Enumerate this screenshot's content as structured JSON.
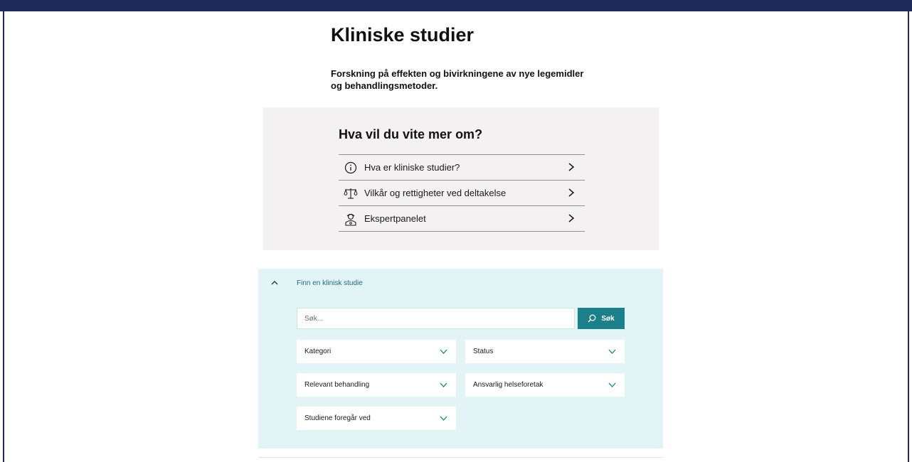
{
  "theme": {
    "topbar_color": "#1e2a57",
    "panel_background": "#f3f1f1",
    "search_panel_background": "#e3f4f6",
    "accent": "#1b7f8c"
  },
  "page": {
    "title": "Kliniske studier",
    "intro": "Forskning på effekten og bivirkningene av nye legemidler og behandlingsmetoder."
  },
  "info_box": {
    "heading": "Hva vil du vite mer om?",
    "links": [
      {
        "label": "Hva er kliniske studier?",
        "icon": "info-circle-icon"
      },
      {
        "label": "Vilkår og rettigheter ved deltakelse",
        "icon": "scales-icon"
      },
      {
        "label": "Ekspertpanelet",
        "icon": "doctor-icon"
      }
    ]
  },
  "search": {
    "toggle_label": "Finn en klinisk studie",
    "toggle_icon": "chevron-up-icon",
    "placeholder": "Søk...",
    "button_label": "Søk",
    "button_icon": "search-icon",
    "filters": [
      {
        "label": "Kategori"
      },
      {
        "label": "Status"
      },
      {
        "label": "Relevant behandling"
      },
      {
        "label": "Ansvarlig helseforetak"
      },
      {
        "label": "Studiene foregår ved"
      }
    ]
  }
}
